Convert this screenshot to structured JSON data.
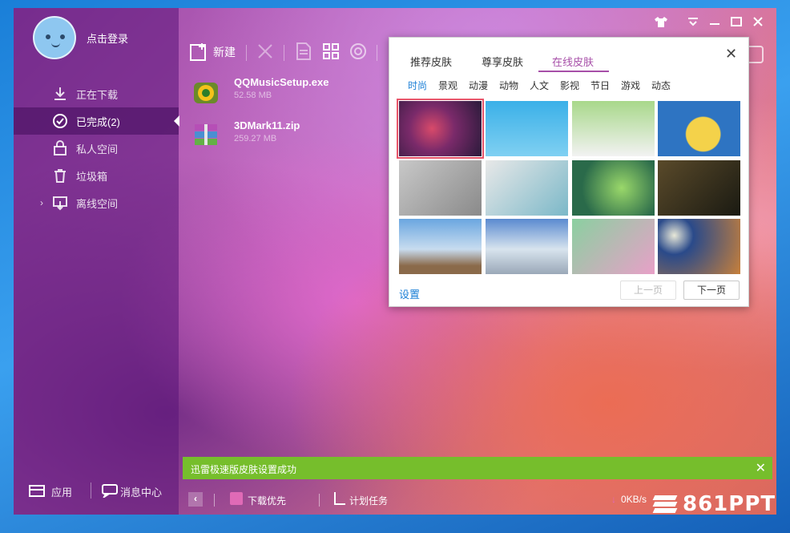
{
  "sidebar": {
    "login": "点击登录",
    "items": [
      {
        "label": "正在下载",
        "icon": "download-icon"
      },
      {
        "label": "已完成(2)",
        "icon": "check-circle-icon",
        "active": true
      },
      {
        "label": "私人空间",
        "icon": "lock-icon"
      },
      {
        "label": "垃圾箱",
        "icon": "trash-icon"
      },
      {
        "label": "离线空间",
        "icon": "cloud-download-icon"
      }
    ],
    "bottom": {
      "app": "应用",
      "messages": "消息中心"
    }
  },
  "toolbar": {
    "new_label": "新建"
  },
  "files": [
    {
      "name": "QQMusicSetup.exe",
      "size": "52.58 MB"
    },
    {
      "name": "3DMark11.zip",
      "size": "259.27 MB"
    }
  ],
  "skin_panel": {
    "tabs": [
      {
        "label": "推荐皮肤"
      },
      {
        "label": "尊享皮肤"
      },
      {
        "label": "在线皮肤",
        "active": true
      }
    ],
    "categories": [
      "时尚",
      "景观",
      "动漫",
      "动物",
      "人文",
      "影视",
      "节日",
      "游戏",
      "动态"
    ],
    "active_category": "时尚",
    "settings": "设置",
    "prev": "上一页",
    "next": "下一页"
  },
  "toast": {
    "message": "迅雷极速版皮肤设置成功"
  },
  "statusbar": {
    "priority": "下载优先",
    "schedule": "计划任务",
    "speed": "0KB/s"
  },
  "watermark": "861PPT",
  "colors": {
    "accent": "#a74fa8",
    "link": "#1b7fd6",
    "toast": "#76be2c"
  }
}
